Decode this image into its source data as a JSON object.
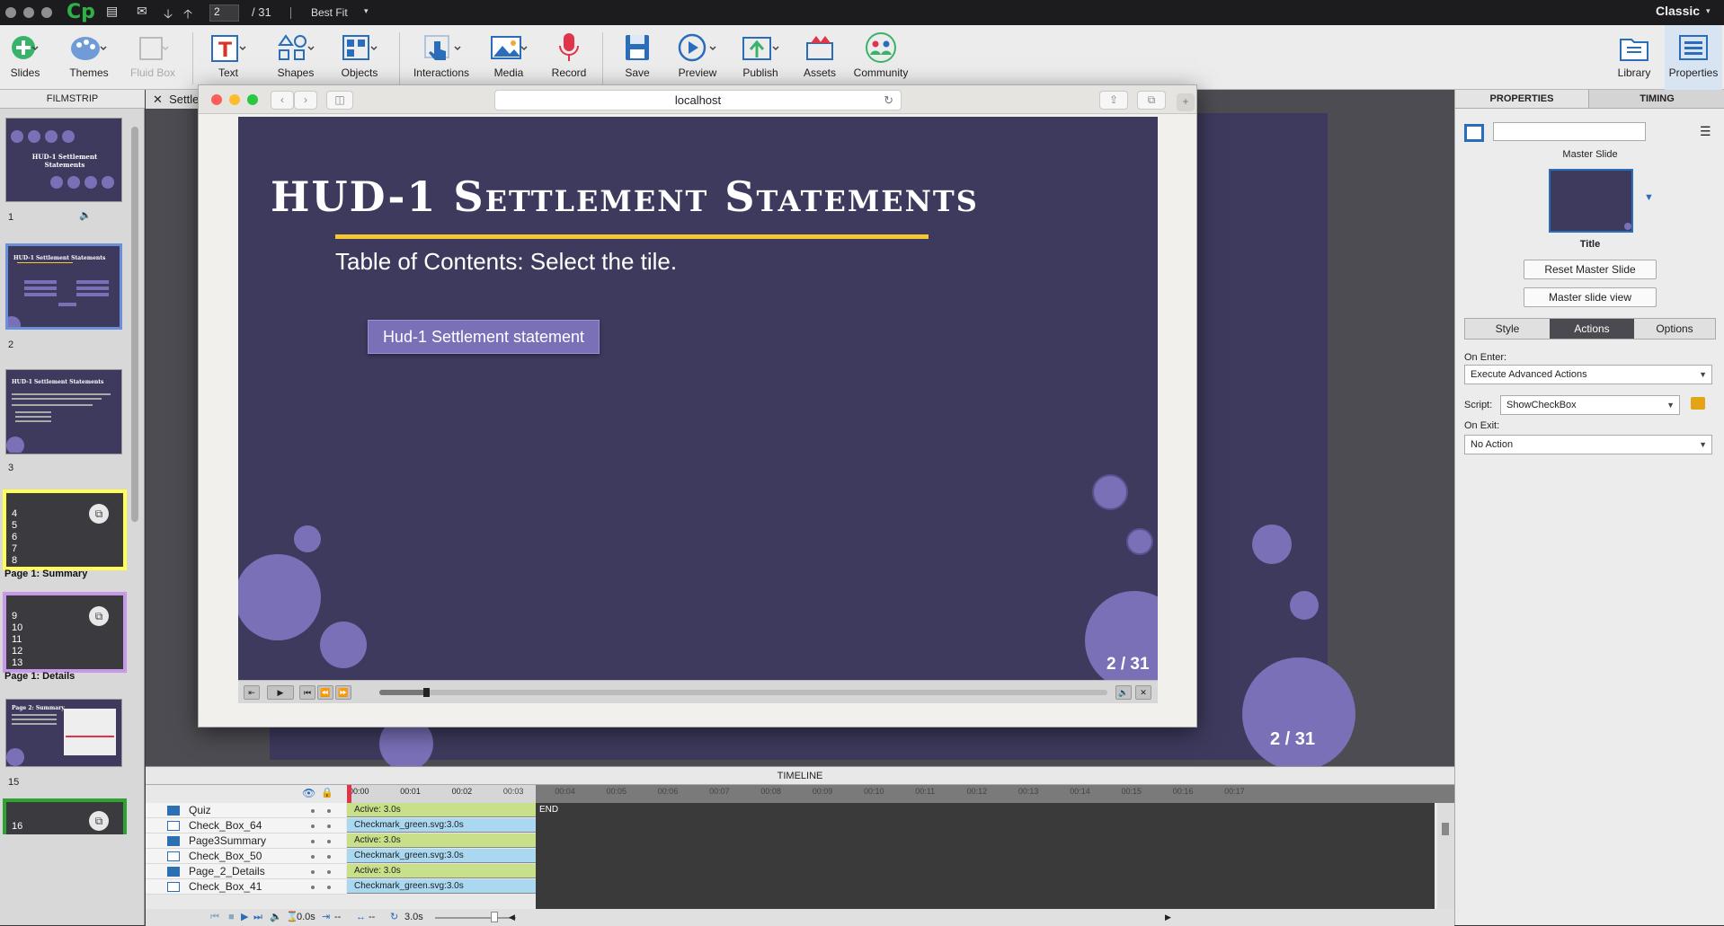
{
  "menubar": {
    "logo": "Cp",
    "current_slide": "2",
    "total_slides": "/ 31",
    "zoom": "Best Fit",
    "workspace": "Classic"
  },
  "toolbar": {
    "items": [
      "Slides",
      "Themes",
      "Fluid Box",
      "Text",
      "Shapes",
      "Objects",
      "Interactions",
      "Media",
      "Record",
      "Save",
      "Preview",
      "Publish",
      "Assets",
      "Community"
    ],
    "right_items": [
      "Library",
      "Properties"
    ]
  },
  "filmstrip": {
    "header": "FILMSTRIP",
    "slide_numbers": [
      "1",
      "2",
      "3",
      "15"
    ],
    "group_summary_nums": [
      "4",
      "5",
      "6",
      "7",
      "8"
    ],
    "group_summary_label": "Page 1: Summary",
    "group_details_nums": [
      "9",
      "10",
      "11",
      "12",
      "13"
    ],
    "group_details_label": "Page 1: Details",
    "group3_nums": [
      "16"
    ],
    "thumb_title": "HUD-1 Settlement Statements",
    "thumb15_title": "Page 2: Summary"
  },
  "stage": {
    "tab_label": "Settle"
  },
  "browser": {
    "url": "localhost"
  },
  "slide": {
    "title": "HUD-1 Settlement Statements",
    "subtitle": "Table of Contents: Select the tile.",
    "tile_label": "Hud-1 Settlement statement",
    "page_indicator": "2 / 31",
    "bg_page_indicator": "2 / 31",
    "colors": {
      "background": "#3e3a5e",
      "accent": "#f3c933",
      "bubble": "#7a70b8"
    }
  },
  "properties": {
    "tabs": [
      "PROPERTIES",
      "TIMING"
    ],
    "master_slide_label": "Master Slide",
    "master_name": "Title",
    "reset_button": "Reset Master Slide",
    "view_button": "Master slide view",
    "subtabs": [
      "Style",
      "Actions",
      "Options"
    ],
    "on_enter_label": "On Enter:",
    "on_enter_value": "Execute Advanced Actions",
    "script_label": "Script:",
    "script_value": "ShowCheckBox",
    "on_exit_label": "On Exit:",
    "on_exit_value": "No Action"
  },
  "timeline": {
    "header": "TIMELINE",
    "ruler": [
      "00:00",
      "00:01",
      "00:02",
      "00:03",
      "00:04",
      "00:05",
      "00:06",
      "00:07",
      "00:08",
      "00:09",
      "00:10",
      "00:11",
      "00:12",
      "00:13",
      "00:14",
      "00:15",
      "00:16",
      "00:17"
    ],
    "end_label": "END",
    "rows": [
      {
        "name": "Quiz",
        "bar": "Active: 3.0s"
      },
      {
        "name": "Check_Box_64",
        "bar": "Checkmark_green.svg:3.0s"
      },
      {
        "name": "Page3Summary",
        "bar": "Active: 3.0s"
      },
      {
        "name": "Check_Box_50",
        "bar": "Checkmark_green.svg:3.0s"
      },
      {
        "name": "Page_2_Details",
        "bar": "Active: 3.0s"
      },
      {
        "name": "Check_Box_41",
        "bar": "Checkmark_green.svg:3.0s"
      }
    ],
    "footer": {
      "start": "0.0s",
      "dash1": "--",
      "dash2": "--",
      "duration": "3.0s"
    }
  }
}
